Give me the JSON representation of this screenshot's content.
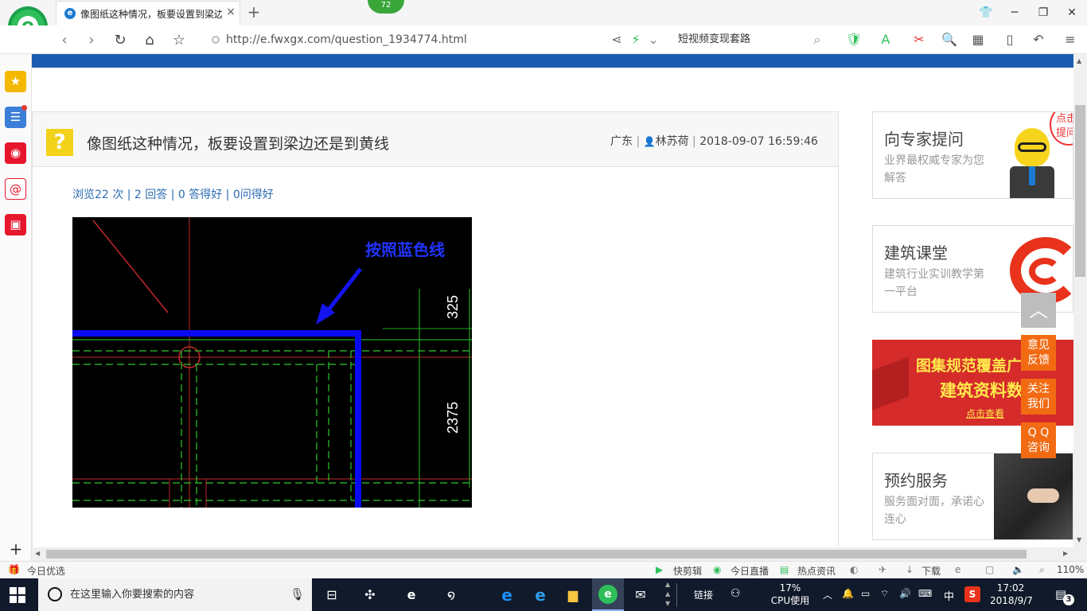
{
  "browser": {
    "tab_title": "像图纸这种情况，板要设置到梁边",
    "tab_close": "×",
    "new_tab": "+",
    "badge_count": "72",
    "url": "http://e.fwxgx.com/question_1934774.html",
    "search_text": "短视频变现套路"
  },
  "question": {
    "title": "像图纸这种情况，板要设置到梁边还是到黄线",
    "region": "广东",
    "author": "林苏荷",
    "datetime": "2018-09-07 16:59:46",
    "icon": "?",
    "stats": "浏览22 次 | 2 回答 | 0 答得好 | 0问得好",
    "image": {
      "annotation": "按照蓝色线",
      "dim_top": "325",
      "dim_bottom": "2375"
    }
  },
  "sidebar_cards": [
    {
      "title": "向专家提问",
      "subtitle": "业界最权威专家为您解答"
    },
    {
      "title": "建筑课堂",
      "subtitle": "建筑行业实训教学第一平台"
    },
    {
      "title": "预约服务",
      "subtitle": "服务面对面，承诺心连心"
    }
  ],
  "mascot_bubble": "点击提问",
  "banner": {
    "line1": "图集规范覆盖广",
    "line2": "建筑资料数",
    "link": "点击查看"
  },
  "float_buttons": {
    "to_top": "︿",
    "feedback": [
      "意见",
      "反馈"
    ],
    "follow": [
      "关注",
      "我们"
    ],
    "qq": [
      "Q Q",
      "咨询"
    ]
  },
  "statusbar": {
    "left": "今日优选",
    "items": [
      "快剪辑",
      "今日直播",
      "热点资讯",
      "下载"
    ],
    "zoom": "110%"
  },
  "taskbar": {
    "search_placeholder": "在这里输入你要搜索的内容",
    "link_label": "链接",
    "cpu_percent": "17%",
    "cpu_label": "CPU使用",
    "ime": "中",
    "time": "17:02",
    "date": "2018/9/7",
    "notifications": "3"
  },
  "colors": {
    "accent_blue": "#1a5db0",
    "float_orange": "#f26b13",
    "question_yellow": "#f2d21b",
    "banner_red": "#d62b2b"
  }
}
